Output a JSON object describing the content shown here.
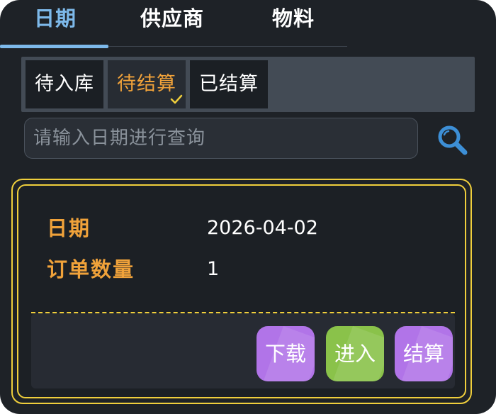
{
  "top_tabs": [
    {
      "label": "日期",
      "active": true
    },
    {
      "label": "供应商",
      "active": false
    },
    {
      "label": "物料",
      "active": false
    }
  ],
  "filters": [
    {
      "label": "待入库",
      "active": false
    },
    {
      "label": "待结算",
      "active": true
    },
    {
      "label": "已结算",
      "active": false
    }
  ],
  "search": {
    "placeholder": "请输入日期进行查询",
    "icon": "search-icon"
  },
  "card": {
    "fields": [
      {
        "label": "日期",
        "value": "2026-04-02"
      },
      {
        "label": "订单数量",
        "value": "1"
      }
    ],
    "actions": [
      {
        "label": "下载",
        "color": "#b174e8"
      },
      {
        "label": "进入",
        "color": "#8ac24a"
      },
      {
        "label": "结算",
        "color": "#b174e8"
      }
    ]
  },
  "colors": {
    "background": "#1e2227",
    "accent_blue": "#7db9ea",
    "accent_orange": "#f0a23a",
    "card_border": "#f0cf3c"
  }
}
